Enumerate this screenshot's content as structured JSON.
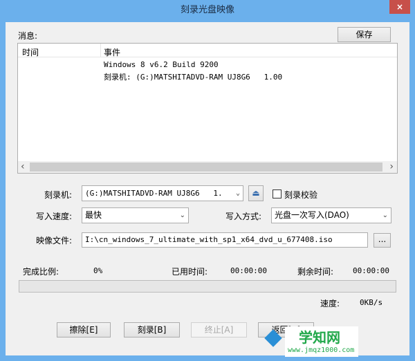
{
  "window": {
    "title": "刻录光盘映像",
    "close": "×"
  },
  "messages": {
    "label": "消息:",
    "save": "保存",
    "columns": [
      "时间",
      "事件"
    ],
    "rows": [
      {
        "time": "",
        "event": "Windows 8 v6.2 Build 9200"
      },
      {
        "time": "",
        "event": "刻录机: (G:)MATSHITADVD-RAM UJ8G6   1.00"
      }
    ],
    "scroll_left": "‹",
    "scroll_right": "›"
  },
  "form": {
    "burner_label": "刻录机:",
    "burner_value": "(G:)MATSHITADVD-RAM UJ8G6   1.",
    "verify_label": "刻录校验",
    "verify_checked": false,
    "speed_label": "写入速度:",
    "speed_value": "最快",
    "mode_label": "写入方式:",
    "mode_value": "光盘一次写入(DAO)",
    "image_label": "映像文件:",
    "image_value": "I:\\cn_windows_7_ultimate_with_sp1_x64_dvd_u_677408.iso",
    "browse": "..."
  },
  "progress": {
    "ratio_label": "完成比例:",
    "ratio_value": "0%",
    "percent": 0,
    "elapsed_label": "已用时间:",
    "elapsed_value": "00:00:00",
    "remaining_label": "剩余时间:",
    "remaining_value": "00:00:00",
    "speed_label": "速度:",
    "speed_value": "0KB/s"
  },
  "buttons": {
    "erase": "擦除[E]",
    "burn": "刻录[B]",
    "stop": "终止[A]",
    "back": "返回[R]"
  },
  "watermark": {
    "title": "学知网",
    "url": "www.jmqz1000.com"
  }
}
